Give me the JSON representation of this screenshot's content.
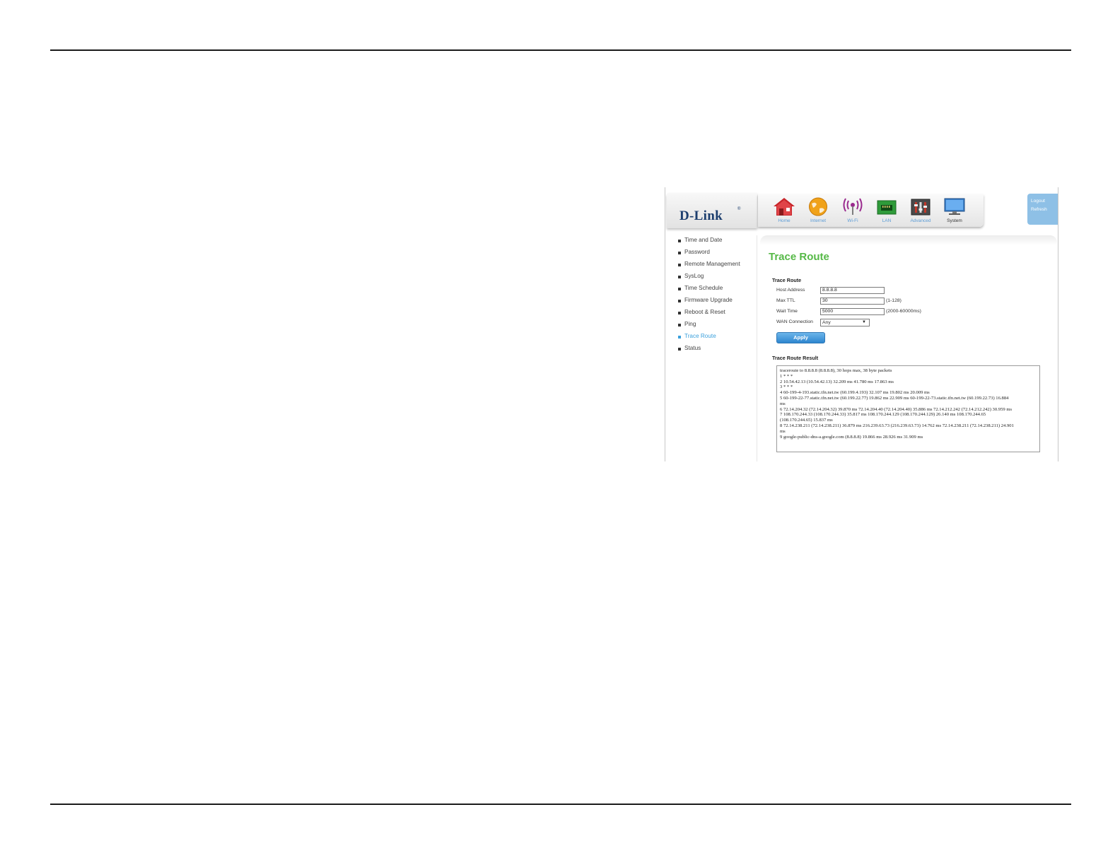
{
  "brand": {
    "logo_text": "D-Link",
    "logo_mark": "®"
  },
  "nav": {
    "items": [
      {
        "label": "Home",
        "icon": "home-icon"
      },
      {
        "label": "Internet",
        "icon": "globe-icon"
      },
      {
        "label": "Wi-Fi",
        "icon": "wifi-icon"
      },
      {
        "label": "LAN",
        "icon": "lan-icon"
      },
      {
        "label": "Advanced",
        "icon": "advanced-icon"
      },
      {
        "label": "System",
        "icon": "monitor-icon",
        "active": true
      }
    ]
  },
  "session": {
    "logout": "Logout",
    "refresh": "Refresh"
  },
  "sidebar": {
    "items": [
      {
        "label": "Time and Date"
      },
      {
        "label": "Password"
      },
      {
        "label": "Remote Management"
      },
      {
        "label": "SysLog"
      },
      {
        "label": "Time Schedule"
      },
      {
        "label": "Firmware Upgrade"
      },
      {
        "label": "Reboot & Reset"
      },
      {
        "label": "Ping"
      },
      {
        "label": "Trace Route",
        "active": true
      },
      {
        "label": "Status"
      }
    ]
  },
  "page": {
    "title": "Trace Route"
  },
  "form": {
    "section_title": "Trace Route",
    "host_address": {
      "label": "Host Address",
      "value": "8.8.8.8"
    },
    "max_ttl": {
      "label": "Max TTL",
      "value": "30",
      "hint": "(1-128)"
    },
    "wait_time": {
      "label": "Wait Time",
      "value": "5000",
      "hint": "(2000-60000ms)"
    },
    "wan_connection": {
      "label": "WAN Connection",
      "value": "Any"
    },
    "apply_label": "Apply"
  },
  "result": {
    "section_title": "Trace Route Result",
    "lines": [
      "traceroute to 8.8.8.8 (8.8.8.8), 30 hops max, 38 byte packets",
      "1 * * *",
      "2 10.54.42.13 (10.54.42.13) 32.209 ms 41.780 ms 17.863 ms",
      "3 * * *",
      "4 60-199-4-193.static.tfn.net.tw (60.199.4.193) 32.107 ms 19.802 ms 20.009 ms",
      "5 60-199-22-77.static.tfn.net.tw (60.199.22.77) 19.862 ms 22.909 ms 60-199-22-73.static.tfn.net.tw (60.199.22.73) 16.884",
      "ms",
      "6 72.14.204.32 (72.14.204.32) 39.870 ms 72.14.204.40 (72.14.204.40) 35.886 ms 72.14.212.242 (72.14.212.242) 30.959 ms",
      "7 108.170.244.33 (108.170.244.33) 35.817 ms 108.170.244.129 (108.170.244.129) 26.140 ms 108.170.244.65",
      "(108.170.244.65) 15.837 ms",
      "8 72.14.238.211 (72.14.238.211) 36.879 ms 216.239.63.73 (216.239.63.73) 14.762 ms 72.14.238.211 (72.14.238.211) 24.901",
      "ms",
      "9 google-public-dns-a.google.com (8.8.8.8) 19.866 ms 28.926 ms 31.909 ms"
    ]
  }
}
